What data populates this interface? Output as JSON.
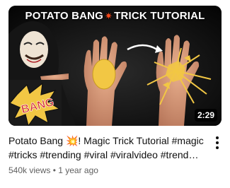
{
  "video": {
    "thumbnail_text_left": "POTATO BANG",
    "thumbnail_burst": "✷",
    "thumbnail_text_right": "TRICK TUTORIAL",
    "thumbnail_bang": "BANG",
    "duration": "2:29",
    "title": "Potato Bang 💥! Magic Trick Tutorial #magic #tricks #trending #viral #viralvideo #trend…",
    "views": "540k views",
    "separator": " • ",
    "age": "1 year ago"
  },
  "icons": {
    "more": "kebab-menu-icon",
    "burst": "explosion-icon"
  },
  "colors": {
    "title_text": "#0f0f0f",
    "meta_text": "#606060",
    "chip_yellow": "#f2c744",
    "bang_red": "#d62b2b"
  }
}
